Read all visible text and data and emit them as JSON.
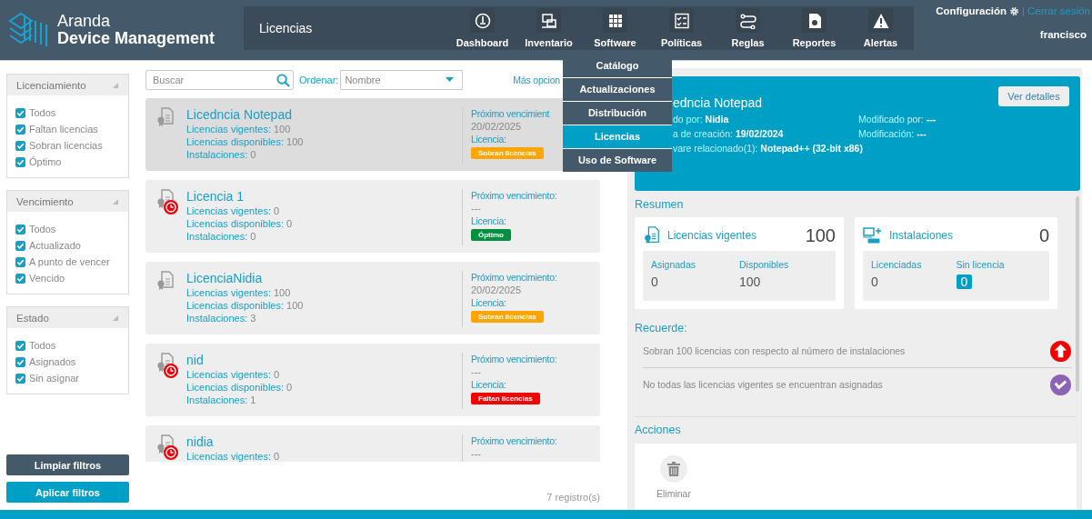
{
  "header": {
    "logo_line1": "Aranda",
    "logo_line2": "Device Management",
    "page_title": "Licencias",
    "nav": [
      {
        "label": "Dashboard",
        "kind": "dashboard"
      },
      {
        "label": "Inventario",
        "kind": "inventory"
      },
      {
        "label": "Software",
        "kind": "software"
      },
      {
        "label": "Políticas",
        "kind": "policies"
      },
      {
        "label": "Reglas",
        "kind": "rules"
      },
      {
        "label": "Reportes",
        "kind": "reports"
      },
      {
        "label": "Alertas",
        "kind": "alerts"
      }
    ],
    "settings": "Configuración",
    "separator": "|",
    "logout": "Cerrar sesión",
    "user": "francisco"
  },
  "software_menu": [
    {
      "label": "Catálogo",
      "selected": false
    },
    {
      "label": "Actualizaciones",
      "selected": false
    },
    {
      "label": "Distribución",
      "selected": false
    },
    {
      "label": "Licencias",
      "selected": true
    },
    {
      "label": "Uso de Software",
      "selected": false
    }
  ],
  "filters": [
    {
      "title": "Licenciamiento",
      "options": [
        {
          "label": "Todos",
          "checked": true
        },
        {
          "label": "Faltan licencias",
          "checked": true
        },
        {
          "label": "Sobran licencias",
          "checked": true
        },
        {
          "label": "Óptimo",
          "checked": true
        }
      ]
    },
    {
      "title": "Vencimiento",
      "options": [
        {
          "label": "Todos",
          "checked": true
        },
        {
          "label": "Actualizado",
          "checked": true
        },
        {
          "label": "A punto de vencer",
          "checked": true
        },
        {
          "label": "Vencido",
          "checked": true
        }
      ]
    },
    {
      "title": "Estado",
      "options": [
        {
          "label": "Todos",
          "checked": true
        },
        {
          "label": "Asignados",
          "checked": true
        },
        {
          "label": "Sin asignar",
          "checked": true
        }
      ]
    }
  ],
  "filter_buttons": {
    "clear": "Limpiar filtros",
    "apply": "Aplicar filtros"
  },
  "toolbar": {
    "search": {
      "placeholder": "Buscar"
    },
    "sort_label": "Ordenar:",
    "sort_value": "Nombre",
    "more": "Más opcion"
  },
  "licenses": [
    {
      "name": "Licedncia Notepad",
      "selected": true,
      "alert": false,
      "fields": [
        {
          "label": "Licencias vigentes:",
          "value": "100"
        },
        {
          "label": "Licencias disponibles:",
          "value": "100"
        },
        {
          "label": "Instalaciones:",
          "value": "0"
        }
      ],
      "expiry_label": "Próximo vencimient",
      "expiry": "20/02/2025",
      "license_label": "Licencia:",
      "badge": {
        "label": "Sobran licencias",
        "color": "#ffa500"
      }
    },
    {
      "name": "Licencia 1",
      "selected": false,
      "alert": true,
      "fields": [
        {
          "label": "Licencias vigentes:",
          "value": "0"
        },
        {
          "label": "Licencias disponibles:",
          "value": "0"
        },
        {
          "label": "Instalaciones:",
          "value": "0"
        }
      ],
      "expiry_label": "Próximo vencimiento:",
      "expiry": "---",
      "license_label": "Licencia:",
      "badge": {
        "label": "Óptimo",
        "color": "#008f3e"
      }
    },
    {
      "name": "LicenciaNidia",
      "selected": false,
      "alert": false,
      "fields": [
        {
          "label": "Licencias vigentes:",
          "value": "100"
        },
        {
          "label": "Licencias disponibles:",
          "value": "100"
        },
        {
          "label": "Instalaciones:",
          "value": "3"
        }
      ],
      "expiry_label": "Próximo vencimiento:",
      "expiry": "20/02/2025",
      "license_label": "Licencia:",
      "badge": {
        "label": "Sobran licencias",
        "color": "#ffa500"
      }
    },
    {
      "name": "nid",
      "selected": false,
      "alert": true,
      "fields": [
        {
          "label": "Licencias vigentes:",
          "value": "0"
        },
        {
          "label": "Licencias disponibles:",
          "value": "0"
        },
        {
          "label": "Instalaciones:",
          "value": "1"
        }
      ],
      "expiry_label": "Próximo vencimiento:",
      "expiry": "---",
      "license_label": "Licencia:",
      "badge": {
        "label": "Faltan licencias",
        "color": "#f40000"
      }
    },
    {
      "name": "nidia",
      "selected": false,
      "alert": true,
      "fields": [
        {
          "label": "Licencias vigentes:",
          "value": "0"
        }
      ],
      "expiry_label": "Próximo vencimiento:",
      "expiry": "---"
    }
  ],
  "record_count": "7 registro(s)",
  "detail": {
    "title": "edncia Notepad",
    "button": "Ver detalles",
    "left_fields": [
      {
        "label": "do por:",
        "value": "Nidia"
      },
      {
        "label": "a de creación:",
        "value": "19/02/2024"
      },
      {
        "label": "vare relacionado(1):",
        "value": "Notepad++ (32-bit x86)"
      }
    ],
    "right_fields": [
      {
        "label": "Modificado por:",
        "value": "---"
      },
      {
        "label": "Modificación:",
        "value": "---"
      }
    ]
  },
  "summary_title": "Resumen",
  "summary_cards": [
    {
      "kind": "licenses",
      "title": "Licencias vigentes",
      "total": "100",
      "stats": [
        {
          "label": "Asignadas",
          "value": "0",
          "highlight": false
        },
        {
          "label": "Disponibles",
          "value": "100",
          "highlight": false
        }
      ]
    },
    {
      "kind": "installs",
      "title": "Instalaciones",
      "total": "0",
      "stats": [
        {
          "label": "Licenciadas",
          "value": "0",
          "highlight": false
        },
        {
          "label": "Sin licencia",
          "value": "0",
          "highlight": true
        }
      ]
    }
  ],
  "reminders_title": "Recuerde:",
  "reminders": [
    {
      "text": "Sobran 100 licencias con respecto al número de instalaciones",
      "kind": "up",
      "color": "#f40000"
    },
    {
      "text": "No todas las licencias vigentes se encuentran asignadas",
      "kind": "check",
      "color": "#8e63b5"
    }
  ],
  "actions_title": "Acciones",
  "actions": [
    {
      "label": "Eliminar",
      "kind": "delete"
    }
  ]
}
